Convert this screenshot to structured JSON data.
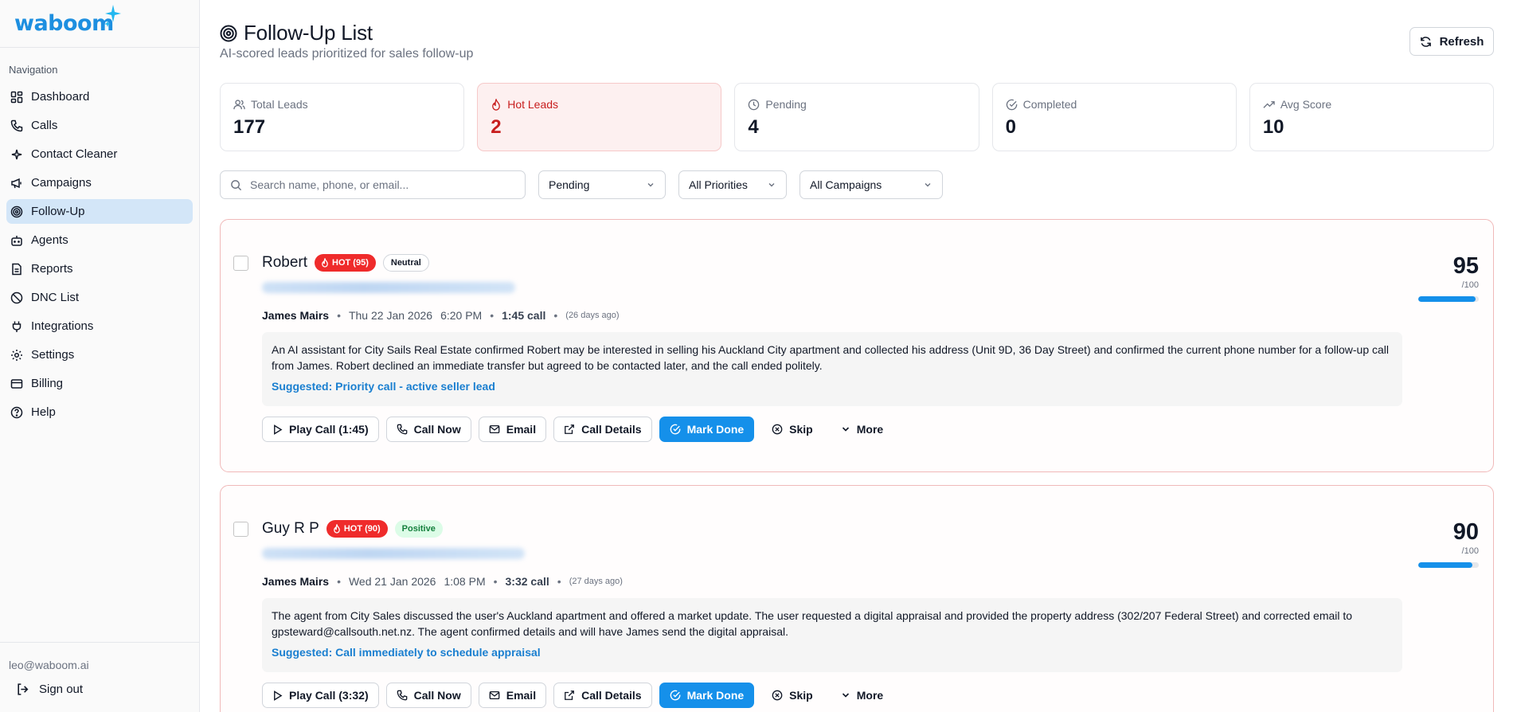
{
  "brand": {
    "name": "waboom",
    "accent": "#1d8fe0"
  },
  "nav": {
    "heading": "Navigation",
    "items": [
      {
        "label": "Dashboard",
        "icon": "grid-icon"
      },
      {
        "label": "Calls",
        "icon": "phone-icon"
      },
      {
        "label": "Contact Cleaner",
        "icon": "sparkles-icon"
      },
      {
        "label": "Campaigns",
        "icon": "megaphone-icon"
      },
      {
        "label": "Follow-Up",
        "icon": "target-icon",
        "active": true
      },
      {
        "label": "Agents",
        "icon": "bot-icon"
      },
      {
        "label": "Reports",
        "icon": "file-icon"
      },
      {
        "label": "DNC List",
        "icon": "ban-icon"
      },
      {
        "label": "Integrations",
        "icon": "plug-icon"
      },
      {
        "label": "Settings",
        "icon": "gear-icon"
      },
      {
        "label": "Billing",
        "icon": "credit-card-icon"
      },
      {
        "label": "Help",
        "icon": "help-circle-icon"
      }
    ],
    "user_email": "leo@waboom.ai",
    "sign_out": "Sign out"
  },
  "header": {
    "title": "Follow-Up List",
    "subtitle": "AI-scored leads prioritized for sales follow-up",
    "refresh": "Refresh"
  },
  "stats": [
    {
      "label": "Total Leads",
      "value": "177",
      "icon": "users-icon"
    },
    {
      "label": "Hot Leads",
      "value": "2",
      "icon": "flame-icon",
      "color": "#c81e1e"
    },
    {
      "label": "Pending",
      "value": "4",
      "icon": "clock-icon"
    },
    {
      "label": "Completed",
      "value": "0",
      "icon": "check-circle-icon"
    },
    {
      "label": "Avg Score",
      "value": "10",
      "icon": "trending-up-icon"
    }
  ],
  "filters": {
    "search_placeholder": "Search name, phone, or email...",
    "status": "Pending",
    "priority": "All Priorities",
    "campaign": "All Campaigns"
  },
  "leads": [
    {
      "name": "Robert",
      "hot_badge": "HOT (95)",
      "sentiment": "Neutral",
      "agent": "James Mairs",
      "date": "Thu 22 Jan 2026",
      "time": "6:20 PM",
      "duration": "1:45 call",
      "ago": "(26 days ago)",
      "summary": "An AI assistant for City Sails Real Estate confirmed Robert may be interested in selling his Auckland City apartment and collected his address (Unit 9D, 36 Day Street) and confirmed the current phone number for a follow-up call from James. Robert declined an immediate transfer but agreed to be contacted later, and the call ended politely.",
      "suggested": "Suggested: Priority call - active seller lead",
      "score": "95",
      "score_pct": 95,
      "score_out": "/100",
      "actions": {
        "play": "Play Call (1:45)",
        "call": "Call Now",
        "email": "Email",
        "details": "Call Details",
        "done": "Mark Done",
        "skip": "Skip",
        "more": "More"
      }
    },
    {
      "name": "Guy R P",
      "hot_badge": "HOT (90)",
      "sentiment": "Positive",
      "agent": "James Mairs",
      "date": "Wed 21 Jan 2026",
      "time": "1:08 PM",
      "duration": "3:32 call",
      "ago": "(27 days ago)",
      "summary": "The agent from City Sales discussed the user's Auckland apartment and offered a market update. The user requested a digital appraisal and provided the property address (302/207 Federal Street) and corrected email to gpsteward@callsouth.net.nz. The agent confirmed details and will have James send the digital appraisal.",
      "suggested": "Suggested: Call immediately to schedule appraisal",
      "score": "90",
      "score_pct": 90,
      "score_out": "/100",
      "actions": {
        "play": "Play Call (3:32)",
        "call": "Call Now",
        "email": "Email",
        "details": "Call Details",
        "done": "Mark Done",
        "skip": "Skip",
        "more": "More"
      }
    }
  ]
}
